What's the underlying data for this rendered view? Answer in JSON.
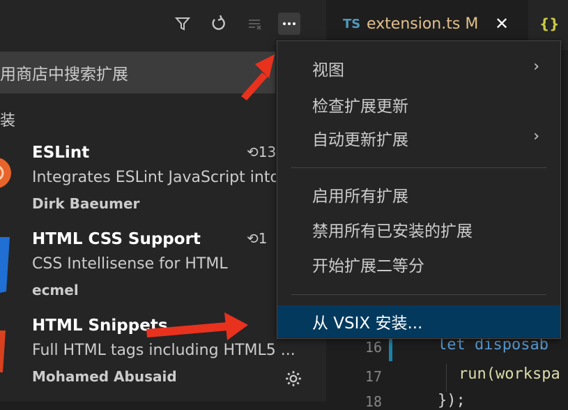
{
  "sidebar": {
    "search_placeholder_visible": "用商店中搜索扩展",
    "section_label": "装",
    "extensions": [
      {
        "name": "ESLint",
        "description": "Integrates ESLint JavaScript into",
        "publisher": "Dirk Baeumer",
        "time": "13"
      },
      {
        "name": "HTML CSS Support",
        "description": "CSS Intellisense for HTML",
        "publisher": "ecmel",
        "time": "1"
      },
      {
        "name": "HTML Snippets",
        "description": "Full HTML tags including HTML5 ...",
        "publisher": "Mohamed Abusaid",
        "time": ""
      }
    ],
    "toolbar_icons": [
      "filter-icon",
      "refresh-icon",
      "clear-icon",
      "more-actions-icon"
    ]
  },
  "editor": {
    "active_tab": {
      "lang_badge": "TS",
      "filename": "extension.ts",
      "status": "M",
      "close": "✕"
    },
    "second_tab_icon": "{}",
    "line_numbers": [
      "16",
      "17",
      "18"
    ],
    "code_lines": [
      "let disposab",
      "run(workspa",
      "});"
    ]
  },
  "menu": {
    "items": [
      {
        "label": "视图",
        "submenu": true
      },
      {
        "label": "检查扩展更新",
        "submenu": false
      },
      {
        "label": "自动更新扩展",
        "submenu": true
      },
      {
        "label": "启用所有扩展",
        "submenu": false
      },
      {
        "label": "禁用所有已安装的扩展",
        "submenu": false
      },
      {
        "label": "开始扩展二等分",
        "submenu": false
      },
      {
        "label": "从 VSIX 安装...",
        "submenu": false,
        "selected": true
      }
    ]
  },
  "colors": {
    "accent_selection": "#04395e",
    "arrow": "#e8321e",
    "modified_tab": "#e2c08d"
  }
}
